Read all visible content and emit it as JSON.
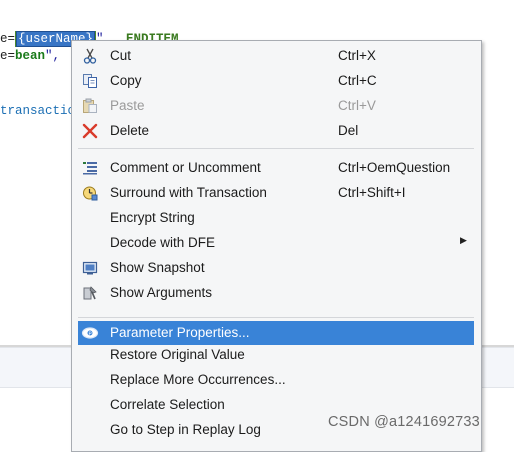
{
  "editor": {
    "line1": {
      "prefix": "e=",
      "selected": "{userName}",
      "suffix": "\",  ",
      "keyword": "ENDITEM"
    },
    "line2": {
      "prefix": "e=",
      "value": "bean",
      "suffix": "\", "
    },
    "line3": {
      "text": "transactio"
    }
  },
  "context_menu": {
    "cut": {
      "label": "Cut",
      "shortcut": "Ctrl+X",
      "icon": "scissors-icon"
    },
    "copy": {
      "label": "Copy",
      "shortcut": "Ctrl+C",
      "icon": "copy-icon"
    },
    "paste": {
      "label": "Paste",
      "shortcut": "Ctrl+V",
      "icon": "paste-icon",
      "disabled": true
    },
    "delete": {
      "label": "Delete",
      "shortcut": "Del",
      "icon": "delete-x-icon"
    },
    "comment": {
      "label": "Comment or Uncomment",
      "shortcut": "Ctrl+OemQuestion",
      "icon": "comment-lines-icon"
    },
    "surround": {
      "label": "Surround with Transaction",
      "shortcut": "Ctrl+Shift+I",
      "icon": "transaction-clock-icon"
    },
    "encrypt": {
      "label": "Encrypt String"
    },
    "decode": {
      "label": "Decode with DFE",
      "has_submenu": true
    },
    "snapshot": {
      "label": "Show Snapshot",
      "icon": "snapshot-monitor-icon"
    },
    "arguments": {
      "label": "Show Arguments",
      "icon": "arguments-tool-icon"
    },
    "param_props": {
      "label": "Parameter Properties...",
      "icon": "parameter-eye-icon",
      "highlighted": true
    },
    "restore": {
      "label": "Restore Original Value"
    },
    "replace_more": {
      "label": "Replace More Occurrences..."
    },
    "correlate": {
      "label": "Correlate Selection"
    },
    "goto_step": {
      "label": "Go to Step in Replay Log"
    }
  },
  "watermark": {
    "text": "CSDN @a1241692733"
  },
  "colors": {
    "menu_bg": "#f5f6f7",
    "highlight": "#3983d7",
    "selection": "#3875c5",
    "keyword": "#3a7a1f",
    "delete_icon": "#d93b2b"
  }
}
